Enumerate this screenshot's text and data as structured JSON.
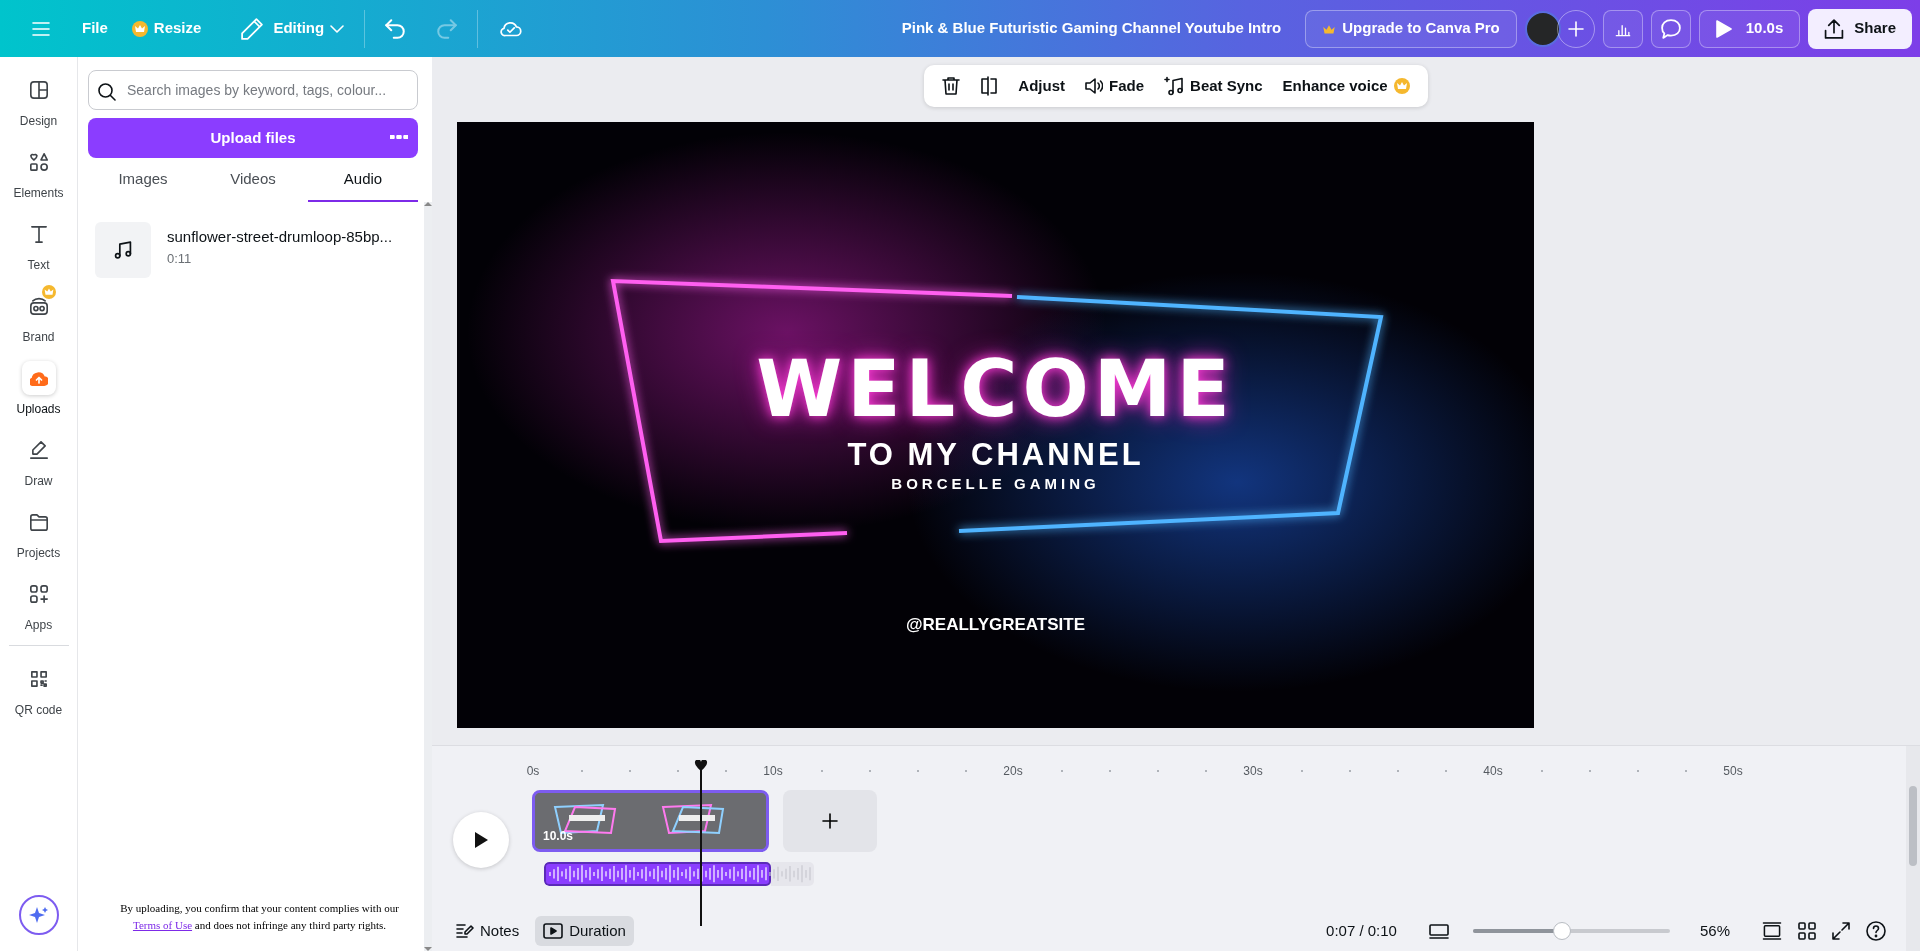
{
  "top_bar": {
    "menu": [
      {
        "label": "File",
        "premium": false
      },
      {
        "label": "Resize",
        "premium": true
      }
    ],
    "mode": "Editing",
    "undo_enabled": true,
    "redo_enabled": false,
    "title": "Pink & Blue Futuristic Gaming Channel Youtube Intro",
    "upgrade": "Upgrade to Canva Pro",
    "play": "10.0s",
    "share": "Share"
  },
  "rail": [
    {
      "label": "Design",
      "selected": false,
      "premium": false
    },
    {
      "label": "Elements",
      "selected": false,
      "premium": false
    },
    {
      "label": "Text",
      "selected": false,
      "premium": false
    },
    {
      "label": "Brand",
      "selected": false,
      "premium": true
    },
    {
      "label": "Uploads",
      "selected": true,
      "premium": false
    },
    {
      "label": "Draw",
      "selected": false,
      "premium": false
    },
    {
      "label": "Projects",
      "selected": false,
      "premium": false
    },
    {
      "label": "Apps",
      "selected": false,
      "premium": false
    },
    {
      "label": "QR code",
      "selected": false,
      "premium": false
    }
  ],
  "panel": {
    "search_placeholder": "Search images by keyword, tags, colour...",
    "upload_button": "Upload files",
    "tabs": [
      {
        "label": "Images",
        "selected": false
      },
      {
        "label": "Videos",
        "selected": false
      },
      {
        "label": "Audio",
        "selected": true
      }
    ],
    "files": [
      {
        "name": "sunflower-street-drumloop-85bp...",
        "duration": "0:11"
      }
    ],
    "footer": {
      "before": "By uploading, you confirm that your content complies with our",
      "link": "Terms of Use",
      "after": "and does not infringe any third party rights."
    }
  },
  "audio_toolbar": {
    "actions": [
      {
        "label": "Adjust",
        "premium": false
      },
      {
        "label": "Fade",
        "premium": false
      },
      {
        "label": "Beat Sync",
        "premium": false
      },
      {
        "label": "Enhance voice",
        "premium": true
      }
    ]
  },
  "design": {
    "headline": "WELCOME",
    "subtitle": "TO MY CHANNEL",
    "brand": "BORCELLE GAMING",
    "handle": "@REALLYGREATSITE"
  },
  "timeline": {
    "ruler": [
      "0s",
      "10s",
      "20s",
      "30s",
      "40s",
      "50s"
    ],
    "playhead": {
      "level": 0.181
    },
    "clip": {
      "duration": "10.0s",
      "selected": true
    },
    "audio": {
      "selected": true
    }
  },
  "bottom_bar": {
    "notes": "Notes",
    "duration": {
      "label": "Duration",
      "selected": true
    },
    "time": "0:07 / 0:10",
    "zoom": {
      "level": 0.45,
      "reading": "56%"
    }
  }
}
